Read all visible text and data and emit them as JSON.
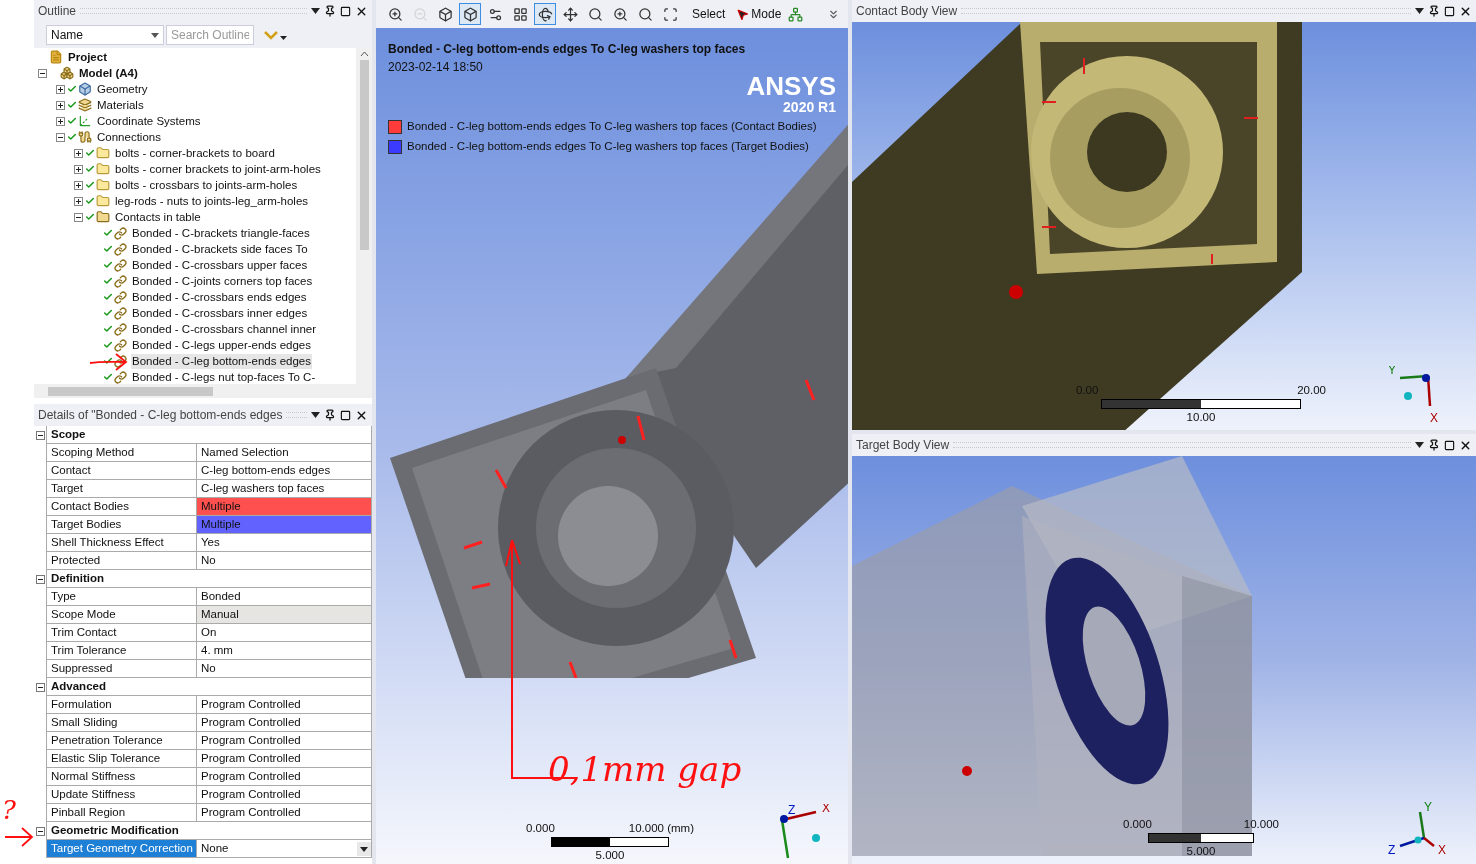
{
  "outline": {
    "title": "Outline",
    "name_filter": "Name",
    "search_placeholder": "Search Outline",
    "tree": [
      {
        "label": "Project",
        "kind": "project",
        "selected": false,
        "children": [
          {
            "label": "Model (A4)",
            "kind": "model",
            "expanded": true,
            "selected": false,
            "children": [
              {
                "label": "Geometry",
                "kind": "geometry",
                "expanded": false,
                "checked": true,
                "selected": false
              },
              {
                "label": "Materials",
                "kind": "materials",
                "expanded": false,
                "checked": true,
                "selected": false
              },
              {
                "label": "Coordinate Systems",
                "kind": "coordinates",
                "expanded": false,
                "checked": true,
                "selected": false
              },
              {
                "label": "Connections",
                "kind": "connections",
                "expanded": true,
                "checked": true,
                "selected": false,
                "children": [
                  {
                    "label": "bolts - corner-brackets to board",
                    "kind": "folder",
                    "expanded": false,
                    "checked": true,
                    "selected": false
                  },
                  {
                    "label": "bolts - corner brackets to joint-arm-holes",
                    "kind": "folder",
                    "expanded": false,
                    "checked": true,
                    "selected": false
                  },
                  {
                    "label": "bolts - crossbars to joints-arm-holes",
                    "kind": "folder",
                    "expanded": false,
                    "checked": true,
                    "selected": false
                  },
                  {
                    "label": "leg-rods - nuts to joints-leg_arm-holes",
                    "kind": "folder",
                    "expanded": false,
                    "checked": true,
                    "selected": false
                  },
                  {
                    "label": "Contacts in table",
                    "kind": "contact-folder",
                    "expanded": true,
                    "checked": true,
                    "selected": false,
                    "children": [
                      {
                        "label": "Bonded - C-brackets triangle-faces",
                        "kind": "contact",
                        "checked": true,
                        "selected": false
                      },
                      {
                        "label": "Bonded - C-brackets side faces To",
                        "kind": "contact",
                        "checked": true,
                        "selected": false
                      },
                      {
                        "label": "Bonded - C-crossbars upper faces",
                        "kind": "contact",
                        "checked": true,
                        "selected": false
                      },
                      {
                        "label": "Bonded - C-joints corners top faces",
                        "kind": "contact",
                        "checked": true,
                        "selected": false
                      },
                      {
                        "label": "Bonded - C-crossbars ends edges",
                        "kind": "contact",
                        "checked": true,
                        "selected": false
                      },
                      {
                        "label": "Bonded - C-crossbars inner edges",
                        "kind": "contact",
                        "checked": true,
                        "selected": false
                      },
                      {
                        "label": "Bonded - C-crossbars channel inner",
                        "kind": "contact",
                        "checked": true,
                        "selected": false
                      },
                      {
                        "label": "Bonded - C-legs upper-ends edges",
                        "kind": "contact",
                        "checked": true,
                        "selected": false
                      },
                      {
                        "label": "Bonded - C-leg bottom-ends edges",
                        "kind": "contact",
                        "checked": true,
                        "selected": true
                      },
                      {
                        "label": "Bonded - C-legs nut top-faces To C-",
                        "kind": "contact",
                        "checked": true,
                        "selected": false
                      }
                    ]
                  }
                ]
              }
            ]
          }
        ]
      }
    ]
  },
  "details": {
    "title": "Details of \"Bonded - C-leg bottom-ends edges",
    "sections": [
      {
        "label": "Scope",
        "expanded": true,
        "rows": [
          {
            "label": "Scoping Method",
            "value": "Named Selection",
            "kind": "text",
            "selected": false
          },
          {
            "label": "Contact",
            "value": "C-leg bottom-ends edges",
            "kind": "text",
            "selected": false
          },
          {
            "label": "Target",
            "value": "C-leg washers top faces",
            "kind": "text",
            "selected": false
          },
          {
            "label": "Contact Bodies",
            "value": "Multiple",
            "kind": "color",
            "color": "#ff5050",
            "selected": false
          },
          {
            "label": "Target Bodies",
            "value": "Multiple",
            "kind": "color",
            "color": "#6262ff",
            "selected": false
          },
          {
            "label": "Shell Thickness Effect",
            "value": "Yes",
            "kind": "text",
            "selected": false
          },
          {
            "label": "Protected",
            "value": "No",
            "kind": "text",
            "selected": false
          }
        ]
      },
      {
        "label": "Definition",
        "expanded": true,
        "rows": [
          {
            "label": "Type",
            "value": "Bonded",
            "kind": "text",
            "selected": false
          },
          {
            "label": "Scope Mode",
            "value": "Manual",
            "kind": "readonly",
            "selected": false
          },
          {
            "label": "Trim Contact",
            "value": "On",
            "kind": "text",
            "selected": false
          },
          {
            "label": "Trim Tolerance",
            "value": "4. mm",
            "kind": "text",
            "selected": false
          },
          {
            "label": "Suppressed",
            "value": "No",
            "kind": "text",
            "selected": false
          }
        ]
      },
      {
        "label": "Advanced",
        "expanded": true,
        "rows": [
          {
            "label": "Formulation",
            "value": "Program Controlled",
            "kind": "text",
            "selected": false
          },
          {
            "label": "Small Sliding",
            "value": "Program Controlled",
            "kind": "text",
            "selected": false
          },
          {
            "label": "Penetration Tolerance",
            "value": "Program Controlled",
            "kind": "text",
            "selected": false
          },
          {
            "label": "Elastic Slip Tolerance",
            "value": "Program Controlled",
            "kind": "text",
            "selected": false
          },
          {
            "label": "Normal Stiffness",
            "value": "Program Controlled",
            "kind": "text",
            "selected": false
          },
          {
            "label": "Update Stiffness",
            "value": "Program Controlled",
            "kind": "text",
            "selected": false
          },
          {
            "label": "Pinball Region",
            "value": "Program Controlled",
            "kind": "text",
            "selected": false
          }
        ]
      },
      {
        "label": "Geometric Modification",
        "expanded": true,
        "rows": [
          {
            "label": "Target Geometry Correction",
            "value": "None",
            "kind": "dropdown",
            "selected": true
          }
        ]
      }
    ]
  },
  "side_annotation": "?",
  "toolbar": {
    "tools": [
      {
        "kind": "zoom-in",
        "selected": false,
        "disabled": false
      },
      {
        "kind": "zoom-out",
        "selected": false,
        "disabled": true
      },
      {
        "kind": "cube",
        "selected": false,
        "disabled": false
      },
      {
        "kind": "cube",
        "selected": true,
        "disabled": false
      },
      {
        "kind": "options",
        "selected": false,
        "disabled": false
      },
      {
        "kind": "layout",
        "selected": false,
        "disabled": false
      },
      {
        "kind": "rotate",
        "selected": true,
        "disabled": false
      },
      {
        "kind": "pan",
        "selected": false,
        "disabled": false
      },
      {
        "kind": "zoom",
        "selected": false,
        "disabled": false
      },
      {
        "kind": "zoom-in",
        "selected": false,
        "disabled": false
      },
      {
        "kind": "search",
        "selected": false,
        "disabled": false
      },
      {
        "kind": "scan",
        "selected": false,
        "disabled": false
      }
    ],
    "select_label": "Select",
    "mode_label": "Mode"
  },
  "viewport": {
    "title": "Bonded - C-leg bottom-ends edges To C-leg washers top faces",
    "date": "2023-02-14 18:50",
    "logo": "ANSYS",
    "version": "2020 R1",
    "legend": [
      {
        "label": "Bonded - C-leg bottom-ends edges To C-leg washers top faces (Contact Bodies)",
        "color": "#ff3b3b"
      },
      {
        "label": "Bonded - C-leg bottom-ends edges To C-leg washers top faces (Target Bodies)",
        "color": "#3b3bff"
      }
    ],
    "annotation": "0,1mm gap",
    "scale": {
      "start": "0.000",
      "end": "10.000 (mm)",
      "middle": "5.000"
    },
    "axes": [
      "Z",
      "X"
    ]
  },
  "contact_view": {
    "title": "Contact Body View",
    "scale": {
      "start": "0.00",
      "end": "20.00",
      "middle": "10.00"
    },
    "axes": [
      "Y",
      "X"
    ]
  },
  "target_view": {
    "title": "Target Body View",
    "scale": {
      "start": "0.000",
      "end": "10.000",
      "middle": "5.000"
    },
    "axes": [
      "Y",
      "Z",
      "X"
    ]
  }
}
